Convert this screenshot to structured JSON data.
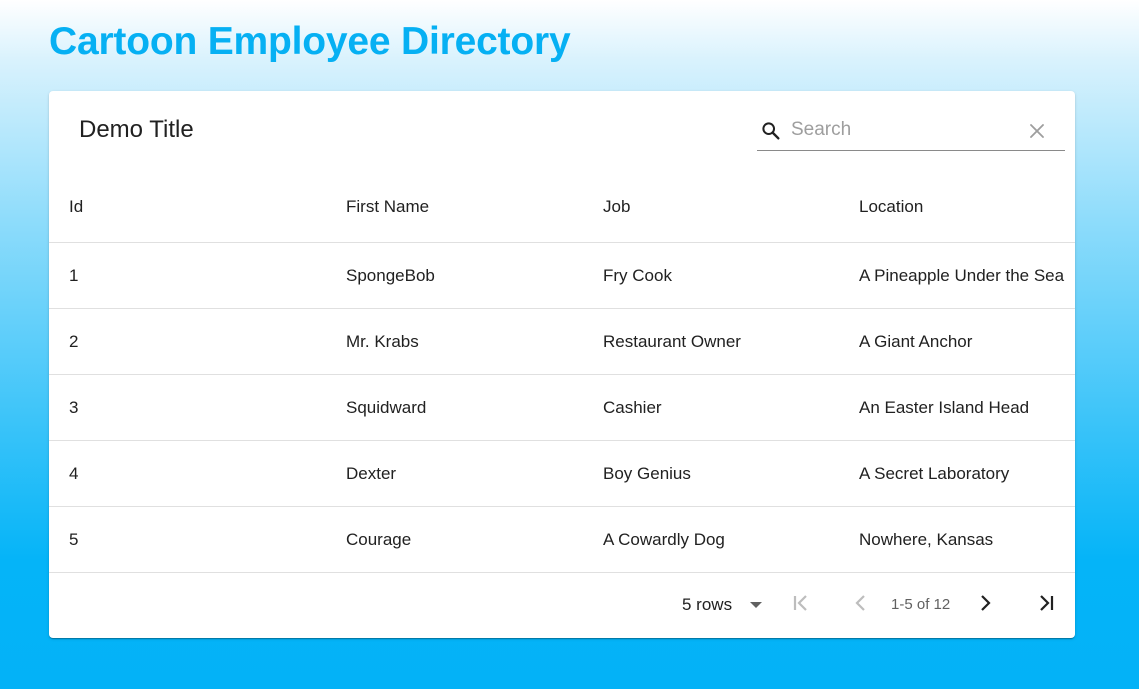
{
  "page": {
    "title": "Cartoon Employee Directory"
  },
  "toolbar": {
    "title": "Demo Title",
    "search_placeholder": "Search",
    "search_value": ""
  },
  "table": {
    "columns": [
      "Id",
      "First Name",
      "Job",
      "Location"
    ],
    "rows": [
      [
        "1",
        "SpongeBob",
        "Fry Cook",
        "A Pineapple Under the Sea"
      ],
      [
        "2",
        "Mr. Krabs",
        "Restaurant Owner",
        "A Giant Anchor"
      ],
      [
        "3",
        "Squidward",
        "Cashier",
        "An Easter Island Head"
      ],
      [
        "4",
        "Dexter",
        "Boy Genius",
        "A Secret Laboratory"
      ],
      [
        "5",
        "Courage",
        "A Cowardly Dog",
        "Nowhere, Kansas"
      ]
    ]
  },
  "pagination": {
    "rows_per_page_label": "5 rows",
    "page_info": "1-5 of 12"
  },
  "icons": {
    "search": "search-icon",
    "clear": "close-icon",
    "dropdown": "arrow-drop-down-icon",
    "first_page": "first-page-icon",
    "previous_page": "chevron-left-icon",
    "next_page": "chevron-right-icon",
    "last_page": "last-page-icon"
  },
  "colors": {
    "title": "#06b0f3",
    "background_bottom": "#03b2f7",
    "card": "#ffffff",
    "disabled_icon": "#bdbdbd"
  }
}
